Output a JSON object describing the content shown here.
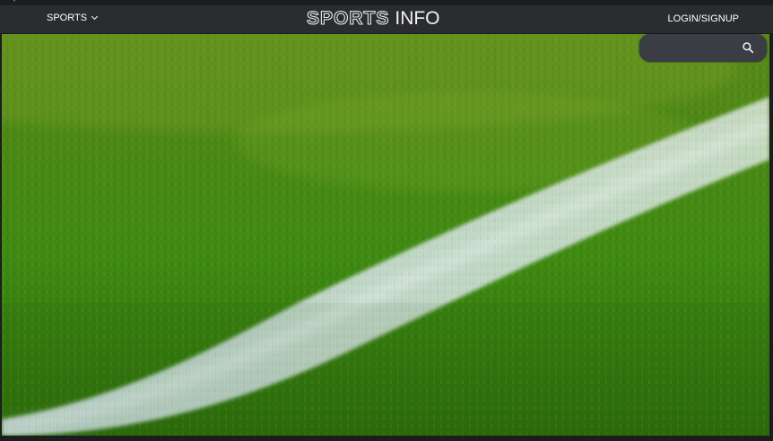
{
  "window": {
    "caret": "▾"
  },
  "navbar": {
    "sports_label": "SPORTS",
    "brand_primary": "SPORTS",
    "brand_secondary": "INFO",
    "login_label": "LOGIN/SIGNUP"
  },
  "search": {
    "placeholder": "",
    "icon": "search-icon"
  },
  "hero": {
    "image": "soccer field grass with white line"
  },
  "colors": {
    "navbar_bg": "#2a2c30",
    "search_bg": "#3a3d44",
    "grass": "#3f7a12",
    "line": "#e6ecef"
  }
}
